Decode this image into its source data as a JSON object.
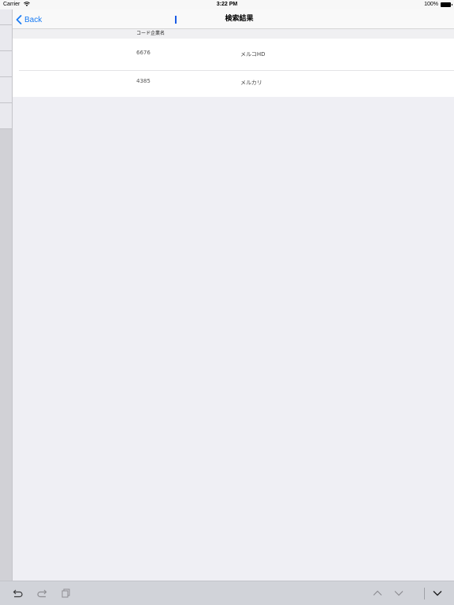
{
  "status_bar": {
    "carrier": "Carrier",
    "time": "3:22 PM",
    "battery": "100%"
  },
  "nav": {
    "back_label": "Back",
    "title": "検索結果"
  },
  "table": {
    "header": "コード企業名",
    "rows": [
      {
        "code": "6676",
        "name": "メルコHD"
      },
      {
        "code": "4385",
        "name": "メルカリ"
      }
    ]
  },
  "toolbar": {
    "icons": [
      "undo-icon",
      "redo-icon",
      "paste-icon",
      "chevron-up-icon",
      "chevron-down-icon",
      "keyboard-dismiss-icon"
    ]
  }
}
